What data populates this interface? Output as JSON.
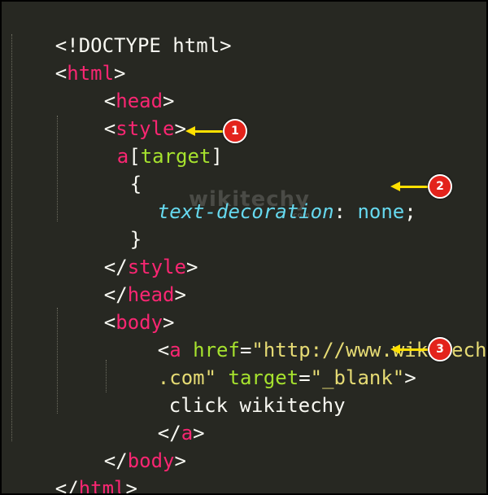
{
  "code": {
    "doctype": "<!DOCTYPE html>",
    "html_open": "html",
    "head_open": "head",
    "style_open": "style",
    "sel_tag": "a",
    "sel_attr": "target",
    "brace_open": "{",
    "prop": "text-decoration",
    "colon": ":",
    "value": "none",
    "semicolon": ";",
    "brace_close": "}",
    "style_close": "style",
    "head_close": "head",
    "body_open": "body",
    "a_tag": "a",
    "href_attr": "href",
    "href_val_1": "\"http://www.wikitechy",
    "href_val_2": ".com\"",
    "target_attr": "target",
    "target_val": "\"_blank\"",
    "link_text": "click wikitechy",
    "a_close": "a",
    "body_close": "body",
    "html_close": "html"
  },
  "annotations": [
    "1",
    "2",
    "3"
  ],
  "watermark": {
    "text": "wikitechy",
    "sub": ".com"
  },
  "colors": {
    "background": "#272822",
    "tag": "#f92672",
    "attribute": "#a6e22e",
    "string": "#e6db74",
    "property": "#66d9ef",
    "arrow": "#ffe000",
    "badge": "#e3231c"
  }
}
